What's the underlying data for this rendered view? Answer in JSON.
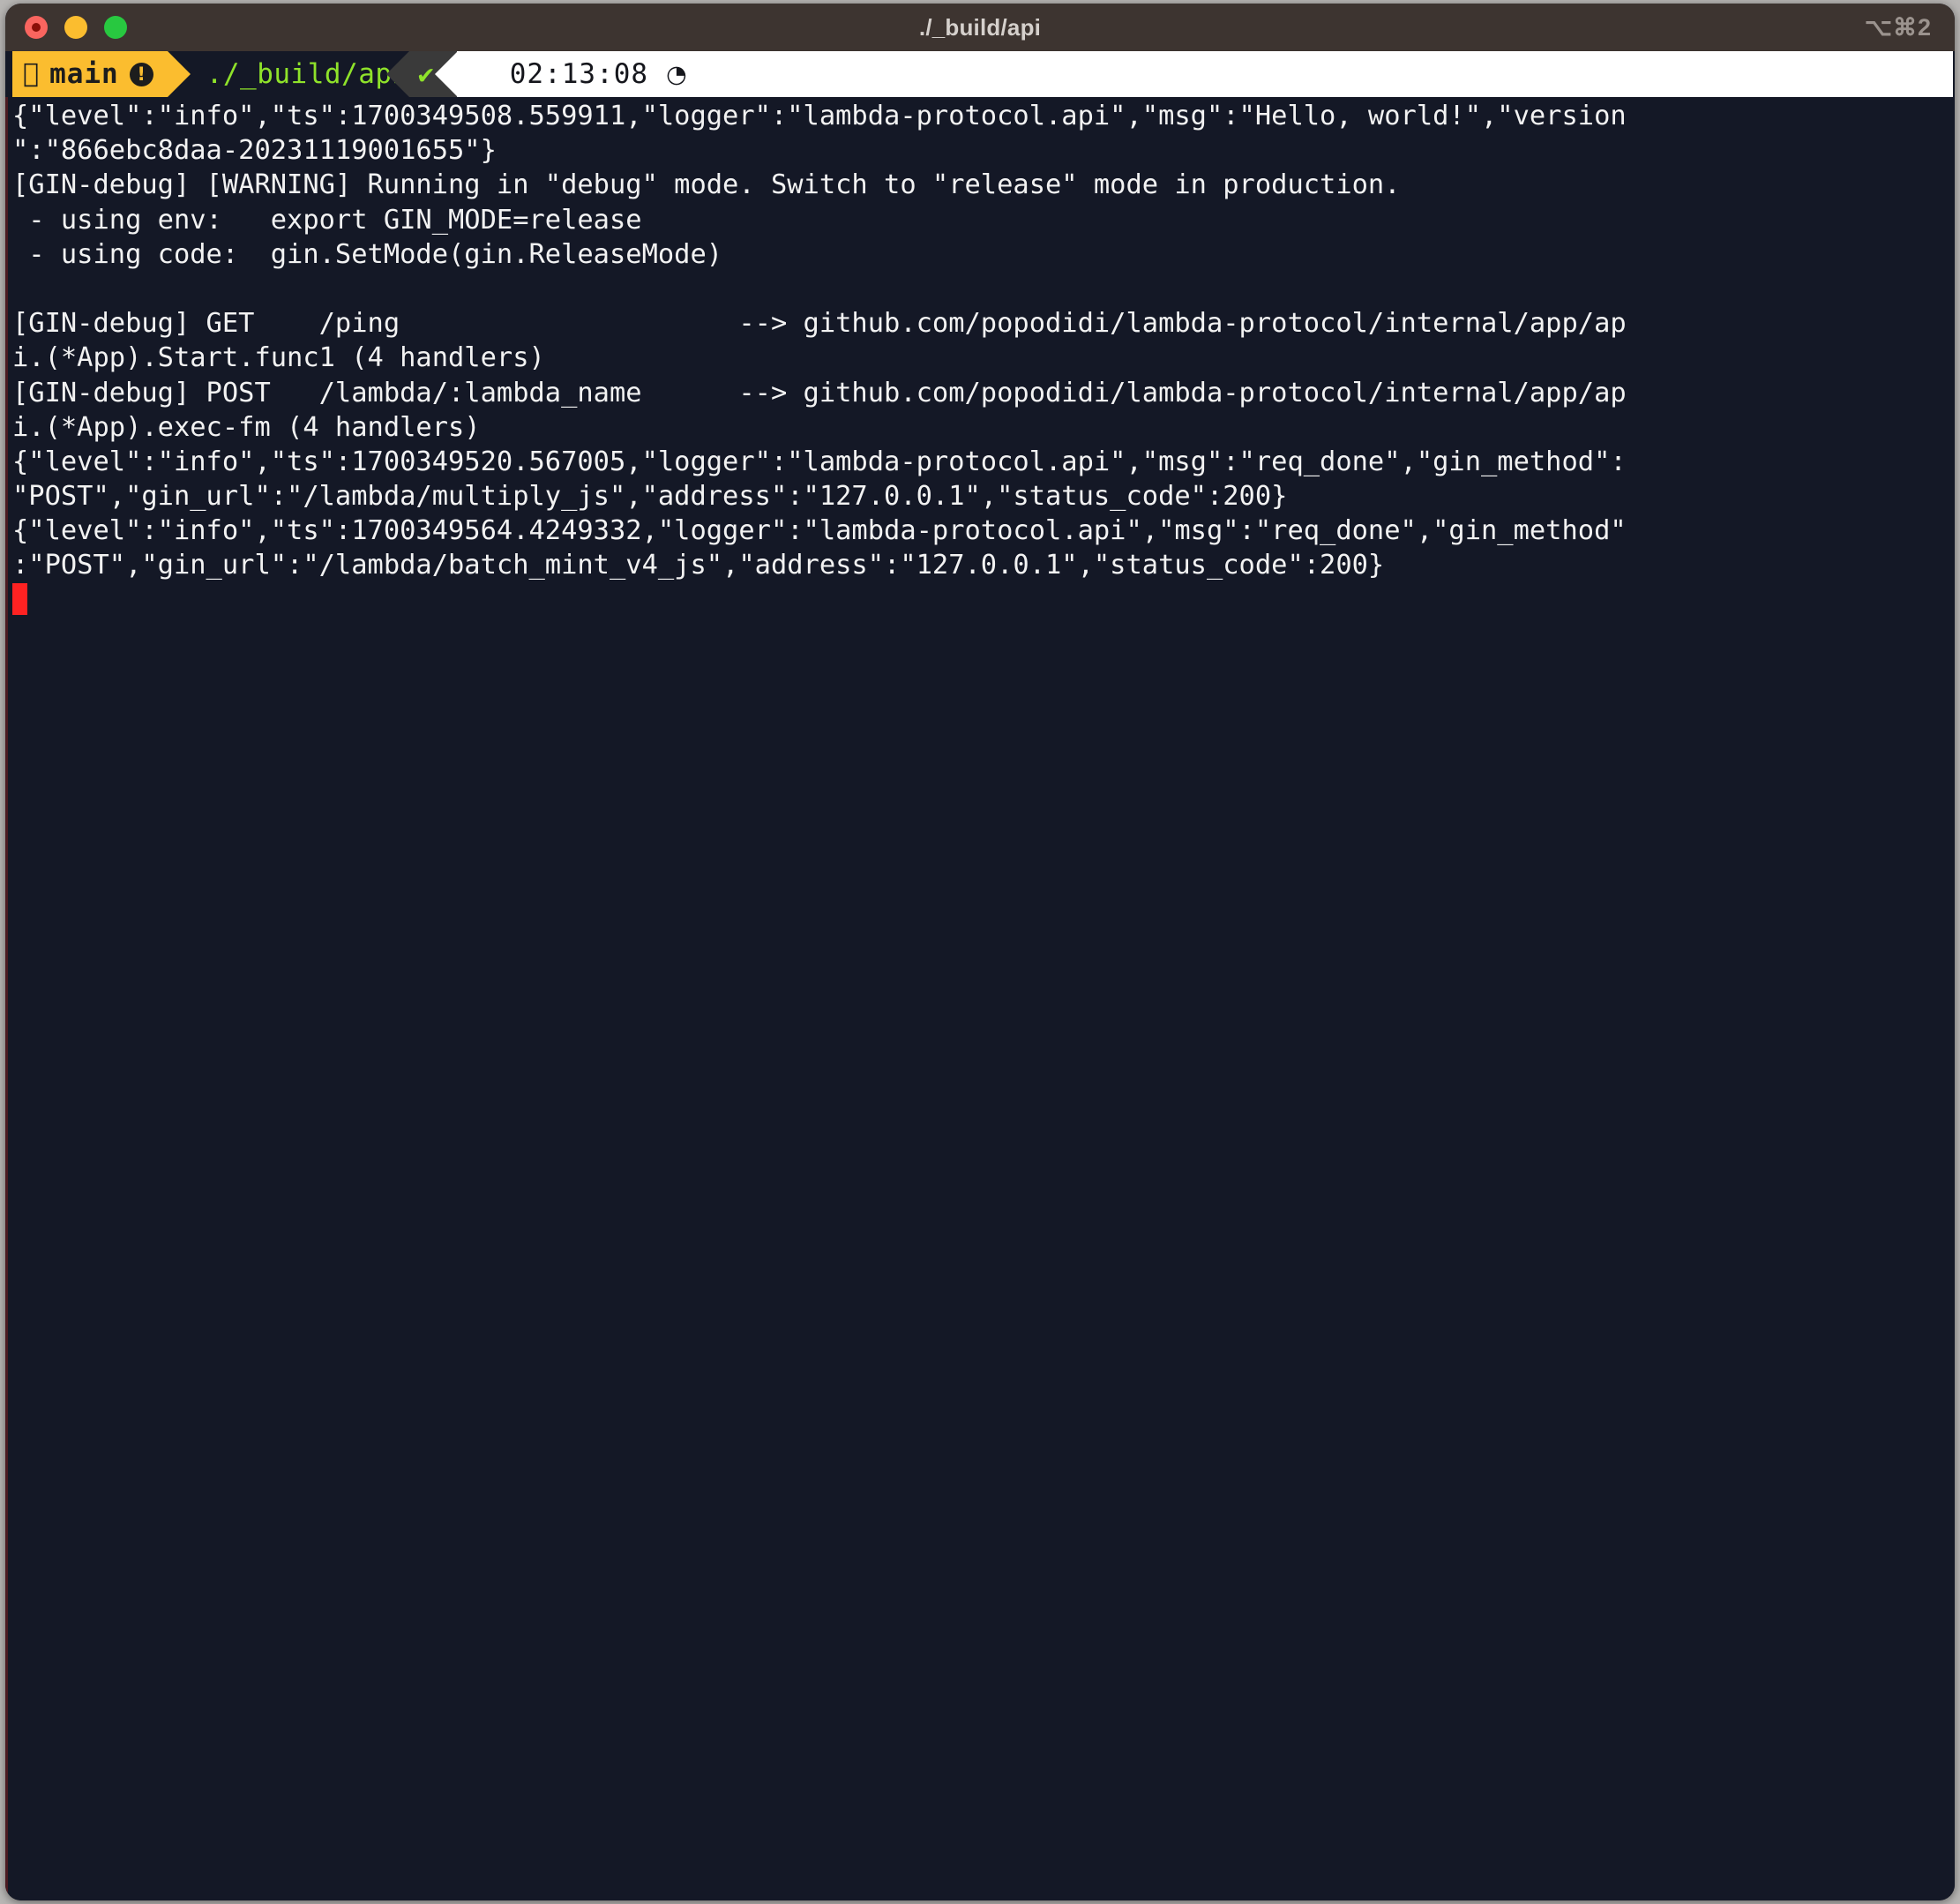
{
  "window": {
    "title": "./_build/api",
    "tab_shortcut": "⌥⌘2",
    "traffic_lights": [
      "close-red",
      "minimize-yellow",
      "zoom-green"
    ]
  },
  "prompt": {
    "branch_icon": "",
    "branch_name": "main",
    "dirty_indicator": "!",
    "command": "./_build/api",
    "status_icon": "✔",
    "time": "02:13:08",
    "clock_icon": "◔",
    "colors": {
      "branch_bg": "#fbbd2f",
      "branch_fg": "#1d1d1d",
      "command_fg": "#8fe22a",
      "status_bg": "#3a3a3a",
      "status_fg": "#8fe22a",
      "time_bg": "#ffffff",
      "time_fg": "#15161c"
    }
  },
  "terminal": {
    "background": "#141826",
    "foreground": "#f2f2f2",
    "cursor_color": "#ff2222",
    "lines": [
      "{\"level\":\"info\",\"ts\":1700349508.559911,\"logger\":\"lambda-protocol.api\",\"msg\":\"Hello, world!\",\"version",
      "\":\"866ebc8daa-20231119001655\"}",
      "[GIN-debug] [WARNING] Running in \"debug\" mode. Switch to \"release\" mode in production.",
      " - using env:   export GIN_MODE=release",
      " - using code:  gin.SetMode(gin.ReleaseMode)",
      "",
      "[GIN-debug] GET    /ping                     --> github.com/popodidi/lambda-protocol/internal/app/ap",
      "i.(*App).Start.func1 (4 handlers)",
      "[GIN-debug] POST   /lambda/:lambda_name      --> github.com/popodidi/lambda-protocol/internal/app/ap",
      "i.(*App).exec-fm (4 handlers)",
      "{\"level\":\"info\",\"ts\":1700349520.567005,\"logger\":\"lambda-protocol.api\",\"msg\":\"req_done\",\"gin_method\":",
      "\"POST\",\"gin_url\":\"/lambda/multiply_js\",\"address\":\"127.0.0.1\",\"status_code\":200}",
      "{\"level\":\"info\",\"ts\":1700349564.4249332,\"logger\":\"lambda-protocol.api\",\"msg\":\"req_done\",\"gin_method\"",
      ":\"POST\",\"gin_url\":\"/lambda/batch_mint_v4_js\",\"address\":\"127.0.0.1\",\"status_code\":200}"
    ]
  }
}
